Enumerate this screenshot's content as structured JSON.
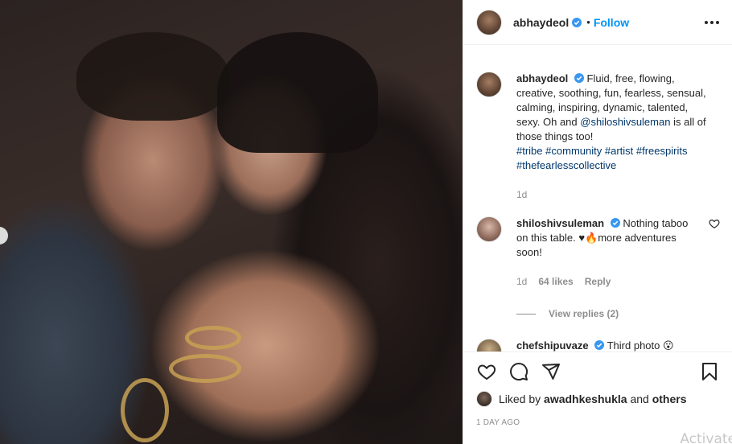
{
  "post": {
    "username": "abhaydeol",
    "follow_label": "Follow",
    "dot": "•"
  },
  "caption": {
    "username": "abhaydeol",
    "text_1": "Fluid, free, flowing, creative, soothing, fun, fearless, sensual, calming, inspiring, dynamic, talented, sexy. Oh and",
    "mention": "@shiloshivsuleman",
    "text_2": "is all of those things too!",
    "tags": [
      "#tribe",
      "#community",
      "#artist",
      "#freespirits",
      "#thefearlesscollective"
    ],
    "time": "1d"
  },
  "comments": [
    {
      "username": "shiloshivsuleman",
      "text": "Nothing taboo on this table. ♥🔥more adventures soon!",
      "time": "1d",
      "likes": "64 likes",
      "reply_label": "Reply",
      "view_replies": "View replies (2)"
    },
    {
      "username": "chefshipuvaze",
      "text": "Third photo 😮"
    }
  ],
  "likes": {
    "prefix": "Liked by",
    "user": "awadhkeshukla",
    "and": "and",
    "others": "others"
  },
  "timestamp": "1 DAY AGO",
  "watermark": "Activate",
  "colors": {
    "accent": "#0095f6",
    "link": "#00376b",
    "muted": "#8e8e8e",
    "verified": "#3897f0"
  },
  "icons": [
    "verified-icon",
    "more-options-icon",
    "heart-icon",
    "comment-icon",
    "share-icon",
    "bookmark-icon"
  ]
}
